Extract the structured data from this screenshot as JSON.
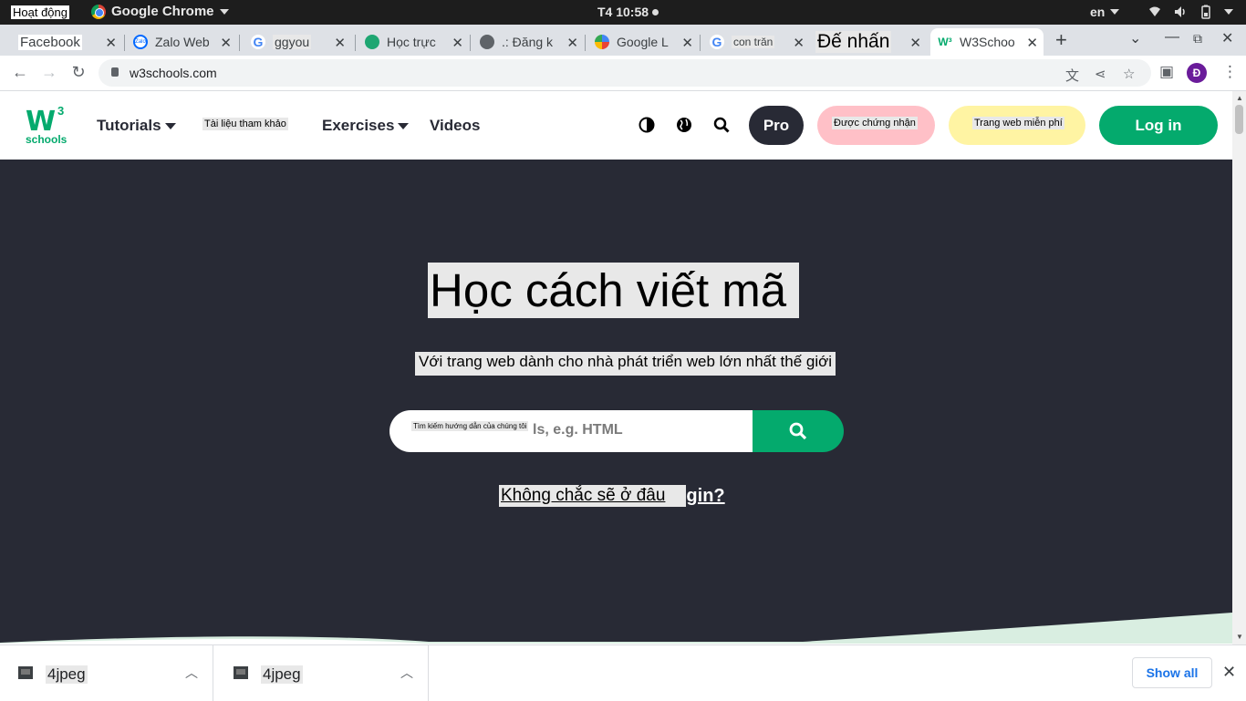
{
  "system_bar": {
    "activities": "Hoạt động",
    "app_name": "Google Chrome",
    "clock": "T4 10:58",
    "language": "en"
  },
  "tabs": [
    {
      "title": "Facebook",
      "favicon": "facebook-icon"
    },
    {
      "title": "Zalo Web",
      "favicon": "zalo-icon"
    },
    {
      "title": "ggyou",
      "favicon": "google-icon"
    },
    {
      "title": "Học trực",
      "favicon": "chatgpt-icon"
    },
    {
      "title": ".: Đăng k",
      "favicon": "globe-icon"
    },
    {
      "title": "Google L",
      "favicon": "google-lens-icon"
    },
    {
      "title": "con trăn",
      "favicon": "google-icon"
    },
    {
      "title": "Đế nhấn",
      "favicon": ""
    },
    {
      "title": "W3Schoo",
      "favicon": "w3schools-icon",
      "active": true
    }
  ],
  "address_bar": {
    "url": "w3schools.com"
  },
  "profile": {
    "initial": "Đ"
  },
  "w3nav": {
    "logo_main": "W",
    "logo_sup": "3",
    "logo_sub": "schools",
    "tutorials": "Tutorials",
    "references": "Tài liệu tham khảo",
    "exercises": "Exercises",
    "videos": "Videos",
    "pro": "Pro",
    "certified": "Được chứng nhận",
    "free_website": "Trang web miễn phí",
    "login": "Log in"
  },
  "hero": {
    "title": "Học cách viết mã",
    "subtitle": "Với trang web dành cho nhà phát triển web lớn nhất thế giới",
    "search_overlay": "Tìm kiếm hướng dẫn của chúng tôi",
    "search_placeholder_tail": "ls, e.g. HTML",
    "begin_overlay": "Không chắc sẽ ở đâu",
    "begin_tail": "gin?"
  },
  "downloads": [
    {
      "name": "4jpeg"
    },
    {
      "name": "4jpeg"
    }
  ],
  "shelf": {
    "show_all": "Show all"
  },
  "colors": {
    "w3_green": "#04aa6d",
    "hero_bg": "#282a35",
    "cert_pink": "#ffc0c7",
    "web_yellow": "#fff4a3"
  }
}
